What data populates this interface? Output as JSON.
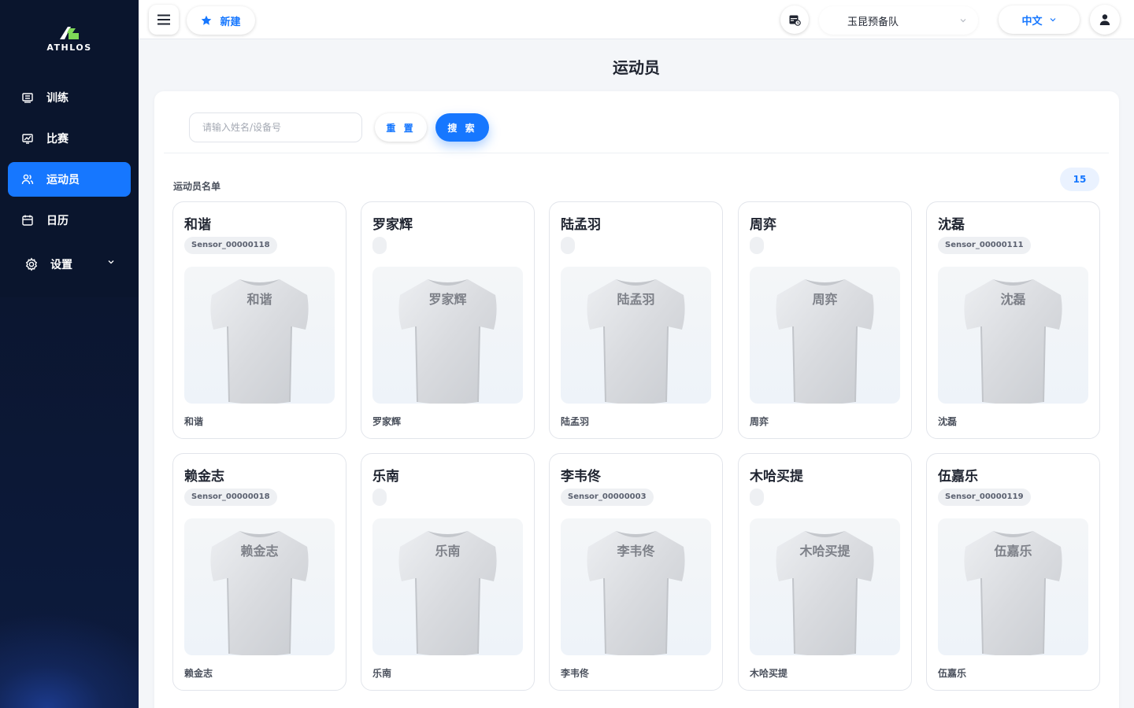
{
  "brand": {
    "name": "ATHLOS"
  },
  "sidebar": {
    "items": [
      {
        "label": "训练",
        "icon": "training-icon"
      },
      {
        "label": "比赛",
        "icon": "match-icon"
      },
      {
        "label": "运动员",
        "icon": "users-icon"
      },
      {
        "label": "日历",
        "icon": "calendar-icon"
      },
      {
        "label": "设置",
        "icon": "gear-icon"
      }
    ]
  },
  "topbar": {
    "new_label": "新建",
    "team": "玉昆预备队",
    "language": "中文"
  },
  "page": {
    "title": "运动员"
  },
  "search": {
    "placeholder": "请输入姓名/设备号",
    "reset_label": "重 置",
    "search_label": "搜 索"
  },
  "list": {
    "label": "运动员名单",
    "count": "15",
    "athletes": [
      {
        "name": "和谐",
        "sensor": "Sensor_00000118"
      },
      {
        "name": "罗家辉",
        "sensor": ""
      },
      {
        "name": "陆孟羽",
        "sensor": ""
      },
      {
        "name": "周弈",
        "sensor": ""
      },
      {
        "name": "沈磊",
        "sensor": "Sensor_00000111"
      },
      {
        "name": "赖金志",
        "sensor": "Sensor_00000018"
      },
      {
        "name": "乐南",
        "sensor": ""
      },
      {
        "name": "李韦佟",
        "sensor": "Sensor_00000003"
      },
      {
        "name": "木哈买提",
        "sensor": ""
      },
      {
        "name": "伍嘉乐",
        "sensor": "Sensor_00000119"
      }
    ]
  },
  "colors": {
    "accent": "#1677ff",
    "sidebar_bg": "#0b1630"
  }
}
